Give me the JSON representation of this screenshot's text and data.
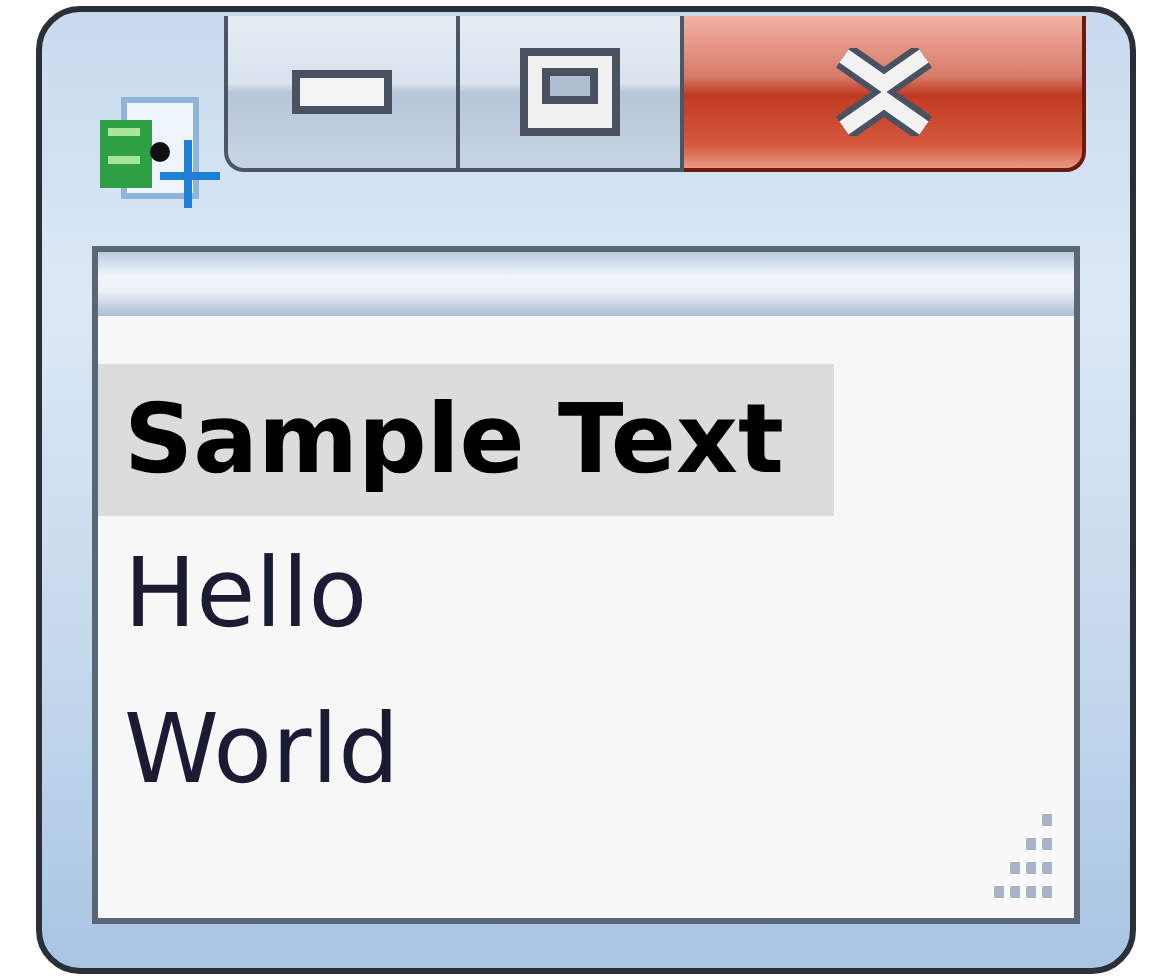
{
  "window": {
    "controls": [
      {
        "kind": "minimize"
      },
      {
        "kind": "maximize"
      },
      {
        "kind": "close"
      }
    ]
  },
  "list": [
    {
      "text": "Sample Text",
      "kind": "header",
      "selected": true
    },
    {
      "text": "Hello",
      "kind": "item",
      "selected": false
    },
    {
      "text": "World",
      "kind": "item",
      "selected": false
    }
  ]
}
